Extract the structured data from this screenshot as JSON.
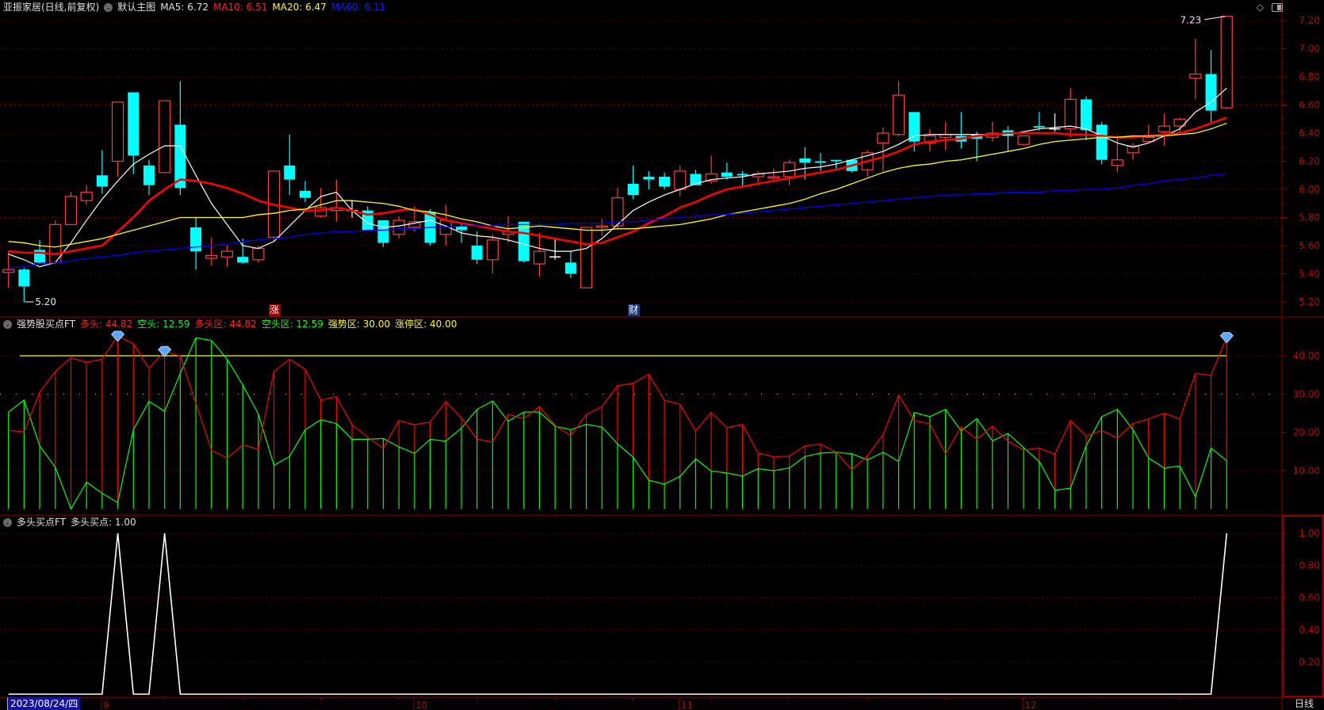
{
  "header": {
    "security": "亚振家居(日线,前复权)",
    "template": "默认主图",
    "ma5": "MA5: 6.72",
    "ma10": "MA10: 6.51",
    "ma20": "MA20: 6.47",
    "ma60": "MA60: 6.11",
    "icon": "chevron-circle-icon"
  },
  "panel1": {
    "name": "强势股买点FT",
    "long": "多头: 44.82",
    "short": "空头: 12.59",
    "long_zone": "多头区: 44.82",
    "short_zone": "空头区: 12.59",
    "strong_zone": "强势区: 30.00",
    "limit_zone": "涨停区: 40.00"
  },
  "panel2": {
    "name": "多头买点FT",
    "buy": "多头买点: 1.00"
  },
  "markers": {
    "limit_up": "涨",
    "finance": "财"
  },
  "axis": {
    "start_date": "2023/08/24/四",
    "months": [
      {
        "label": "9",
        "bar": 6
      },
      {
        "label": "10",
        "bar": 26
      },
      {
        "label": "11",
        "bar": 43
      },
      {
        "label": "12",
        "bar": 65
      }
    ],
    "period": "日线"
  },
  "colors": {
    "up": "#ff3c3c",
    "down": "#00ffff",
    "doji": "#ffffff",
    "ma5": "#ffffff",
    "ma10": "#ff0000",
    "ma20": "#ffff00",
    "ma60": "#0000ff",
    "grid": "#8b0000",
    "long": "#ff0000",
    "short": "#00ff00"
  },
  "chart_data": [
    {
      "type": "candlestick",
      "ylim": [
        5.2,
        7.2
      ],
      "yticks": [
        "7.20",
        "7.00",
        "6.80",
        "6.60",
        "6.40",
        "6.20",
        "6.00",
        "5.80",
        "5.60",
        "5.40",
        "5.20"
      ],
      "grid": true,
      "high_label": "7.23",
      "low_label": "5.20",
      "ohlc": [
        [
          5.41,
          5.56,
          5.3,
          5.43
        ],
        [
          5.43,
          5.44,
          5.2,
          5.31
        ],
        [
          5.57,
          5.64,
          5.47,
          5.48
        ],
        [
          5.48,
          5.78,
          5.47,
          5.75
        ],
        [
          5.75,
          5.98,
          5.75,
          5.95
        ],
        [
          5.92,
          6.03,
          5.89,
          5.98
        ],
        [
          6.1,
          6.28,
          5.97,
          6.02
        ],
        [
          6.2,
          6.62,
          6.09,
          6.62
        ],
        [
          6.69,
          6.69,
          6.11,
          6.24
        ],
        [
          6.17,
          6.21,
          5.96,
          6.03
        ],
        [
          6.12,
          6.63,
          6.12,
          6.63
        ],
        [
          6.46,
          6.77,
          5.96,
          6.01
        ],
        [
          5.73,
          5.8,
          5.43,
          5.56
        ],
        [
          5.51,
          5.66,
          5.46,
          5.53
        ],
        [
          5.52,
          5.6,
          5.45,
          5.56
        ],
        [
          5.52,
          5.65,
          5.47,
          5.48
        ],
        [
          5.5,
          5.6,
          5.48,
          5.58
        ],
        [
          5.66,
          6.13,
          5.63,
          6.13
        ],
        [
          6.17,
          6.39,
          5.96,
          6.07
        ],
        [
          5.99,
          6.06,
          5.91,
          5.94
        ],
        [
          5.81,
          6.01,
          5.8,
          5.87
        ],
        [
          5.85,
          6.07,
          5.77,
          5.87
        ],
        [
          5.85,
          5.92,
          5.8,
          5.85
        ],
        [
          5.85,
          5.88,
          5.71,
          5.71
        ],
        [
          5.78,
          5.78,
          5.59,
          5.62
        ],
        [
          5.68,
          5.81,
          5.65,
          5.78
        ],
        [
          5.73,
          5.88,
          5.7,
          5.77
        ],
        [
          5.84,
          5.86,
          5.6,
          5.62
        ],
        [
          5.68,
          5.89,
          5.6,
          5.78
        ],
        [
          5.74,
          5.76,
          5.62,
          5.71
        ],
        [
          5.6,
          5.7,
          5.47,
          5.5
        ],
        [
          5.5,
          5.68,
          5.4,
          5.64
        ],
        [
          5.68,
          5.81,
          5.62,
          5.7
        ],
        [
          5.77,
          5.77,
          5.48,
          5.49
        ],
        [
          5.47,
          5.69,
          5.38,
          5.56
        ],
        [
          5.52,
          5.65,
          5.5,
          5.52
        ],
        [
          5.48,
          5.56,
          5.37,
          5.4
        ],
        [
          5.3,
          5.73,
          5.3,
          5.73
        ],
        [
          5.73,
          5.79,
          5.67,
          5.74
        ],
        [
          5.74,
          6.01,
          5.72,
          5.94
        ],
        [
          6.04,
          6.17,
          5.93,
          5.96
        ],
        [
          6.09,
          6.13,
          6.0,
          6.07
        ],
        [
          6.09,
          6.12,
          6.0,
          6.02
        ],
        [
          6.0,
          6.17,
          5.95,
          6.13
        ],
        [
          6.11,
          6.14,
          6.03,
          6.03
        ],
        [
          6.06,
          6.24,
          6.04,
          6.11
        ],
        [
          6.12,
          6.19,
          6.07,
          6.09
        ],
        [
          6.11,
          6.13,
          6.02,
          6.1
        ],
        [
          6.09,
          6.13,
          6.05,
          6.11
        ],
        [
          6.08,
          6.15,
          6.06,
          6.09
        ],
        [
          6.09,
          6.21,
          6.03,
          6.19
        ],
        [
          6.22,
          6.3,
          6.07,
          6.19
        ],
        [
          6.2,
          6.26,
          6.13,
          6.19
        ],
        [
          6.21,
          6.21,
          6.14,
          6.2
        ],
        [
          6.21,
          6.21,
          6.12,
          6.13
        ],
        [
          6.14,
          6.28,
          6.09,
          6.26
        ],
        [
          6.33,
          6.44,
          6.13,
          6.4
        ],
        [
          6.39,
          6.77,
          6.38,
          6.67
        ],
        [
          6.55,
          6.55,
          6.27,
          6.34
        ],
        [
          6.33,
          6.43,
          6.27,
          6.38
        ],
        [
          6.37,
          6.48,
          6.28,
          6.39
        ],
        [
          6.38,
          6.55,
          6.29,
          6.34
        ],
        [
          6.39,
          6.41,
          6.2,
          6.36
        ],
        [
          6.37,
          6.48,
          6.34,
          6.4
        ],
        [
          6.42,
          6.45,
          6.27,
          6.38
        ],
        [
          6.32,
          6.38,
          6.32,
          6.38
        ],
        [
          6.45,
          6.55,
          6.42,
          6.44
        ],
        [
          6.43,
          6.54,
          6.41,
          6.43
        ],
        [
          6.43,
          6.72,
          6.37,
          6.64
        ],
        [
          6.64,
          6.66,
          6.35,
          6.42
        ],
        [
          6.46,
          6.48,
          6.18,
          6.21
        ],
        [
          6.17,
          6.38,
          6.12,
          6.21
        ],
        [
          6.26,
          6.33,
          6.21,
          6.31
        ],
        [
          6.34,
          6.46,
          6.34,
          6.37
        ],
        [
          6.41,
          6.54,
          6.31,
          6.45
        ],
        [
          6.45,
          6.51,
          6.39,
          6.5
        ],
        [
          6.79,
          7.07,
          6.64,
          6.82
        ],
        [
          6.82,
          6.99,
          6.47,
          6.56
        ],
        [
          6.58,
          7.23,
          6.57,
          7.23
        ]
      ],
      "series": [
        {
          "name": "MA5",
          "values": [
            5.54,
            5.5,
            5.45,
            5.48,
            5.62,
            5.78,
            5.93,
            6.06,
            6.18,
            6.25,
            6.31,
            6.31,
            6.1,
            5.9,
            5.75,
            5.6,
            5.58,
            5.63,
            5.74,
            5.85,
            5.95,
            5.98,
            5.85,
            5.76,
            5.73,
            5.74,
            5.76,
            5.78,
            5.74,
            5.69,
            5.67,
            5.66,
            5.64,
            5.61,
            5.58,
            5.56,
            5.56,
            5.58,
            5.65,
            5.75,
            5.85,
            5.91,
            5.96,
            6.0,
            6.04,
            6.07,
            6.08,
            6.09,
            6.11,
            6.12,
            6.13,
            6.15,
            6.16,
            6.18,
            6.21,
            6.24,
            6.27,
            6.32,
            6.38,
            6.39,
            6.39,
            6.39,
            6.39,
            6.39,
            6.39,
            6.41,
            6.43,
            6.44,
            6.45,
            6.43,
            6.38,
            6.33,
            6.3,
            6.33,
            6.38,
            6.43,
            6.55,
            6.62,
            6.72
          ]
        },
        {
          "name": "MA10",
          "values": [
            5.56,
            5.55,
            5.55,
            5.54,
            5.56,
            5.58,
            5.6,
            5.7,
            5.8,
            5.92,
            6.0,
            6.07,
            6.06,
            6.04,
            6.01,
            5.97,
            5.92,
            5.89,
            5.87,
            5.85,
            5.85,
            5.87,
            5.85,
            5.82,
            5.83,
            5.85,
            5.86,
            5.82,
            5.78,
            5.76,
            5.74,
            5.72,
            5.7,
            5.69,
            5.67,
            5.65,
            5.63,
            5.61,
            5.62,
            5.66,
            5.7,
            5.76,
            5.81,
            5.87,
            5.91,
            5.96,
            6.0,
            6.02,
            6.04,
            6.06,
            6.08,
            6.1,
            6.12,
            6.14,
            6.17,
            6.2,
            6.23,
            6.27,
            6.32,
            6.34,
            6.35,
            6.36,
            6.38,
            6.39,
            6.4,
            6.4,
            6.4,
            6.4,
            6.39,
            6.39,
            6.38,
            6.37,
            6.37,
            6.38,
            6.39,
            6.4,
            6.43,
            6.47,
            6.51
          ]
        },
        {
          "name": "MA20",
          "values": [
            5.63,
            5.62,
            5.6,
            5.59,
            5.61,
            5.63,
            5.65,
            5.68,
            5.71,
            5.74,
            5.77,
            5.8,
            5.8,
            5.8,
            5.8,
            5.8,
            5.82,
            5.83,
            5.85,
            5.86,
            5.89,
            5.92,
            5.92,
            5.91,
            5.9,
            5.88,
            5.85,
            5.84,
            5.82,
            5.79,
            5.77,
            5.74,
            5.72,
            5.73,
            5.74,
            5.73,
            5.72,
            5.71,
            5.71,
            5.72,
            5.72,
            5.73,
            5.74,
            5.75,
            5.77,
            5.79,
            5.82,
            5.84,
            5.86,
            5.88,
            5.9,
            5.93,
            5.97,
            6.0,
            6.04,
            6.08,
            6.12,
            6.15,
            6.17,
            6.18,
            6.2,
            6.21,
            6.23,
            6.25,
            6.27,
            6.29,
            6.32,
            6.34,
            6.35,
            6.36,
            6.37,
            6.37,
            6.38,
            6.38,
            6.38,
            6.39,
            6.4,
            6.43,
            6.47
          ]
        },
        {
          "name": "MA60",
          "values": [
            5.44,
            5.45,
            5.47,
            5.48,
            5.49,
            5.51,
            5.52,
            5.53,
            5.55,
            5.56,
            5.57,
            5.58,
            5.59,
            5.6,
            5.61,
            5.63,
            5.64,
            5.65,
            5.66,
            5.68,
            5.69,
            5.7,
            5.7,
            5.71,
            5.71,
            5.72,
            5.72,
            5.73,
            5.73,
            5.74,
            5.74,
            5.74,
            5.75,
            5.75,
            5.75,
            5.75,
            5.76,
            5.76,
            5.76,
            5.77,
            5.77,
            5.78,
            5.79,
            5.8,
            5.81,
            5.82,
            5.82,
            5.83,
            5.84,
            5.85,
            5.86,
            5.87,
            5.88,
            5.89,
            5.9,
            5.91,
            5.92,
            5.93,
            5.94,
            5.95,
            5.96,
            5.96,
            5.97,
            5.97,
            5.98,
            5.98,
            5.98,
            5.99,
            5.99,
            6.0,
            6.0,
            6.01,
            6.03,
            6.04,
            6.06,
            6.07,
            6.08,
            6.1,
            6.11
          ]
        }
      ],
      "events": [
        {
          "bar": 17,
          "label": "涨"
        },
        {
          "bar": 40,
          "label": "财"
        }
      ]
    },
    {
      "type": "line",
      "ylim": [
        0,
        48
      ],
      "yticks": [
        "40.00",
        "30.00",
        "20.00",
        "10.00"
      ],
      "reference_lines": [
        {
          "value": 40,
          "style": "solid",
          "color": "#ffff00"
        },
        {
          "value": 30,
          "style": "dotted",
          "color": "#ffff00"
        }
      ],
      "series": [
        {
          "name": "多头",
          "values": [
            20.5,
            20.1,
            30.5,
            35.9,
            39.5,
            38.3,
            39.1,
            45.2,
            43.1,
            36.7,
            41.2,
            39.9,
            27.6,
            15.3,
            13.3,
            16.7,
            15.6,
            35.9,
            39.1,
            36.5,
            28.4,
            29.3,
            22.0,
            18.7,
            15.9,
            23.1,
            22.0,
            22.7,
            28.0,
            23.8,
            18.2,
            17.5,
            24.7,
            23.6,
            26.7,
            21.8,
            19.1,
            24.7,
            26.7,
            32.2,
            32.8,
            35.2,
            28.4,
            27.3,
            20.4,
            25.2,
            21.2,
            22.1,
            14.6,
            13.6,
            13.8,
            16.5,
            16.9,
            14.8,
            10.2,
            13.9,
            19.4,
            29.7,
            23.1,
            22.2,
            14.4,
            21.4,
            18.2,
            21.6,
            17.7,
            15.4,
            15.9,
            14.3,
            23.1,
            19.0,
            20.5,
            18.5,
            22.3,
            23.5,
            25.0,
            23.5,
            35.4,
            34.9,
            44.82
          ]
        },
        {
          "name": "空头",
          "values": [
            25.3,
            28.4,
            16.5,
            10.9,
            0,
            7.0,
            4.1,
            1.7,
            20.7,
            28.1,
            25.5,
            35.4,
            44.7,
            44.0,
            39.1,
            32.4,
            24.8,
            11.4,
            13.7,
            20.7,
            23.3,
            22.3,
            18.2,
            18.2,
            18.4,
            16.2,
            14.5,
            18.2,
            17.7,
            21.1,
            26.0,
            28.2,
            22.9,
            25.3,
            25.3,
            21.6,
            20.7,
            22.1,
            21.4,
            17.0,
            13.5,
            7.5,
            6.5,
            8.5,
            13.1,
            9.9,
            9.4,
            8.6,
            10.5,
            10.0,
            10.7,
            13.7,
            14.6,
            14.8,
            14.4,
            12.8,
            14.8,
            12.4,
            25.2,
            24.1,
            26.0,
            20.4,
            23.6,
            17.8,
            19.7,
            16.0,
            12.4,
            4.9,
            5.4,
            16.5,
            24.1,
            26.0,
            20.7,
            13.3,
            10.7,
            11.2,
            3.2,
            15.9,
            12.59
          ]
        }
      ],
      "signal_bars": [
        7,
        10,
        78
      ],
      "signal_icon": "diamond-icon"
    },
    {
      "type": "line",
      "ylim": [
        0,
        1.05
      ],
      "yticks": [
        "1.00",
        "0.80",
        "0.60",
        "0.40",
        "0.20"
      ],
      "series": [
        {
          "name": "多头买点",
          "values": [
            0,
            0,
            0,
            0,
            0,
            0,
            0,
            1,
            0,
            0,
            1,
            0,
            0,
            0,
            0,
            0,
            0,
            0,
            0,
            0,
            0,
            0,
            0,
            0,
            0,
            0,
            0,
            0,
            0,
            0,
            0,
            0,
            0,
            0,
            0,
            0,
            0,
            0,
            0,
            0,
            0,
            0,
            0,
            0,
            0,
            0,
            0,
            0,
            0,
            0,
            0,
            0,
            0,
            0,
            0,
            0,
            0,
            0,
            0,
            0,
            0,
            0,
            0,
            0,
            0,
            0,
            0,
            0,
            0,
            0,
            0,
            0,
            0,
            0,
            0,
            0,
            0,
            0,
            1
          ]
        }
      ]
    }
  ]
}
